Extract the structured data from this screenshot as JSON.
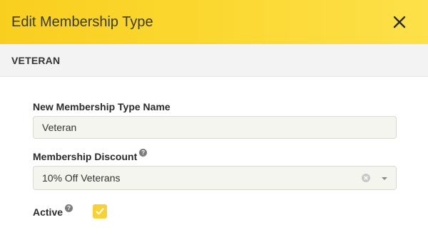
{
  "dialog": {
    "title": "Edit Membership Type",
    "subtitle": "VETERAN"
  },
  "form": {
    "name_label": "New Membership Type Name",
    "name_value": "Veteran",
    "discount_label": "Membership Discount",
    "discount_selected": "10% Off Veterans",
    "active_label": "Active",
    "active_checked": true,
    "help_glyph": "?"
  },
  "icons": {
    "close": "close-icon",
    "help": "help-icon",
    "clear": "clear-icon",
    "dropdown": "chevron-down-icon",
    "check": "check-icon"
  },
  "colors": {
    "header_accent": "#fbd72e",
    "checkbox_accent": "#f7d237"
  }
}
